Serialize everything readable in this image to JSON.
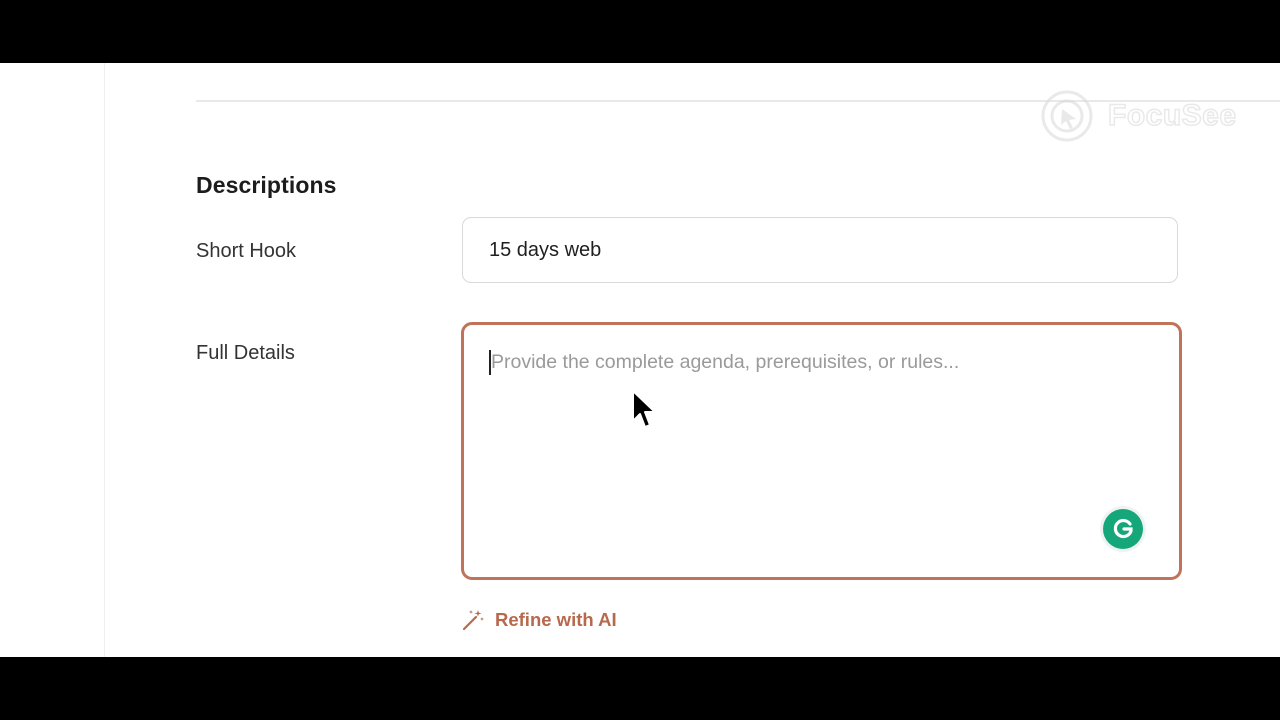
{
  "section": {
    "title": "Descriptions"
  },
  "fields": {
    "short_hook": {
      "label": "Short Hook",
      "value": "15 days web"
    },
    "full_details": {
      "label": "Full Details",
      "placeholder": "Provide the complete agenda, prerequisites, or rules...",
      "value": ""
    }
  },
  "actions": {
    "refine_label": "Refine with AI"
  },
  "watermark": {
    "brand": "FocuSee"
  },
  "colors": {
    "accent": "#c0735a",
    "refine_text": "#b8694c",
    "grammarly": "#15a77a"
  },
  "icons": {
    "refine": "magic-wand-icon",
    "grammarly": "grammarly-icon",
    "watermark_logo": "focusee-logo-icon",
    "pointer": "mouse-cursor-icon"
  }
}
